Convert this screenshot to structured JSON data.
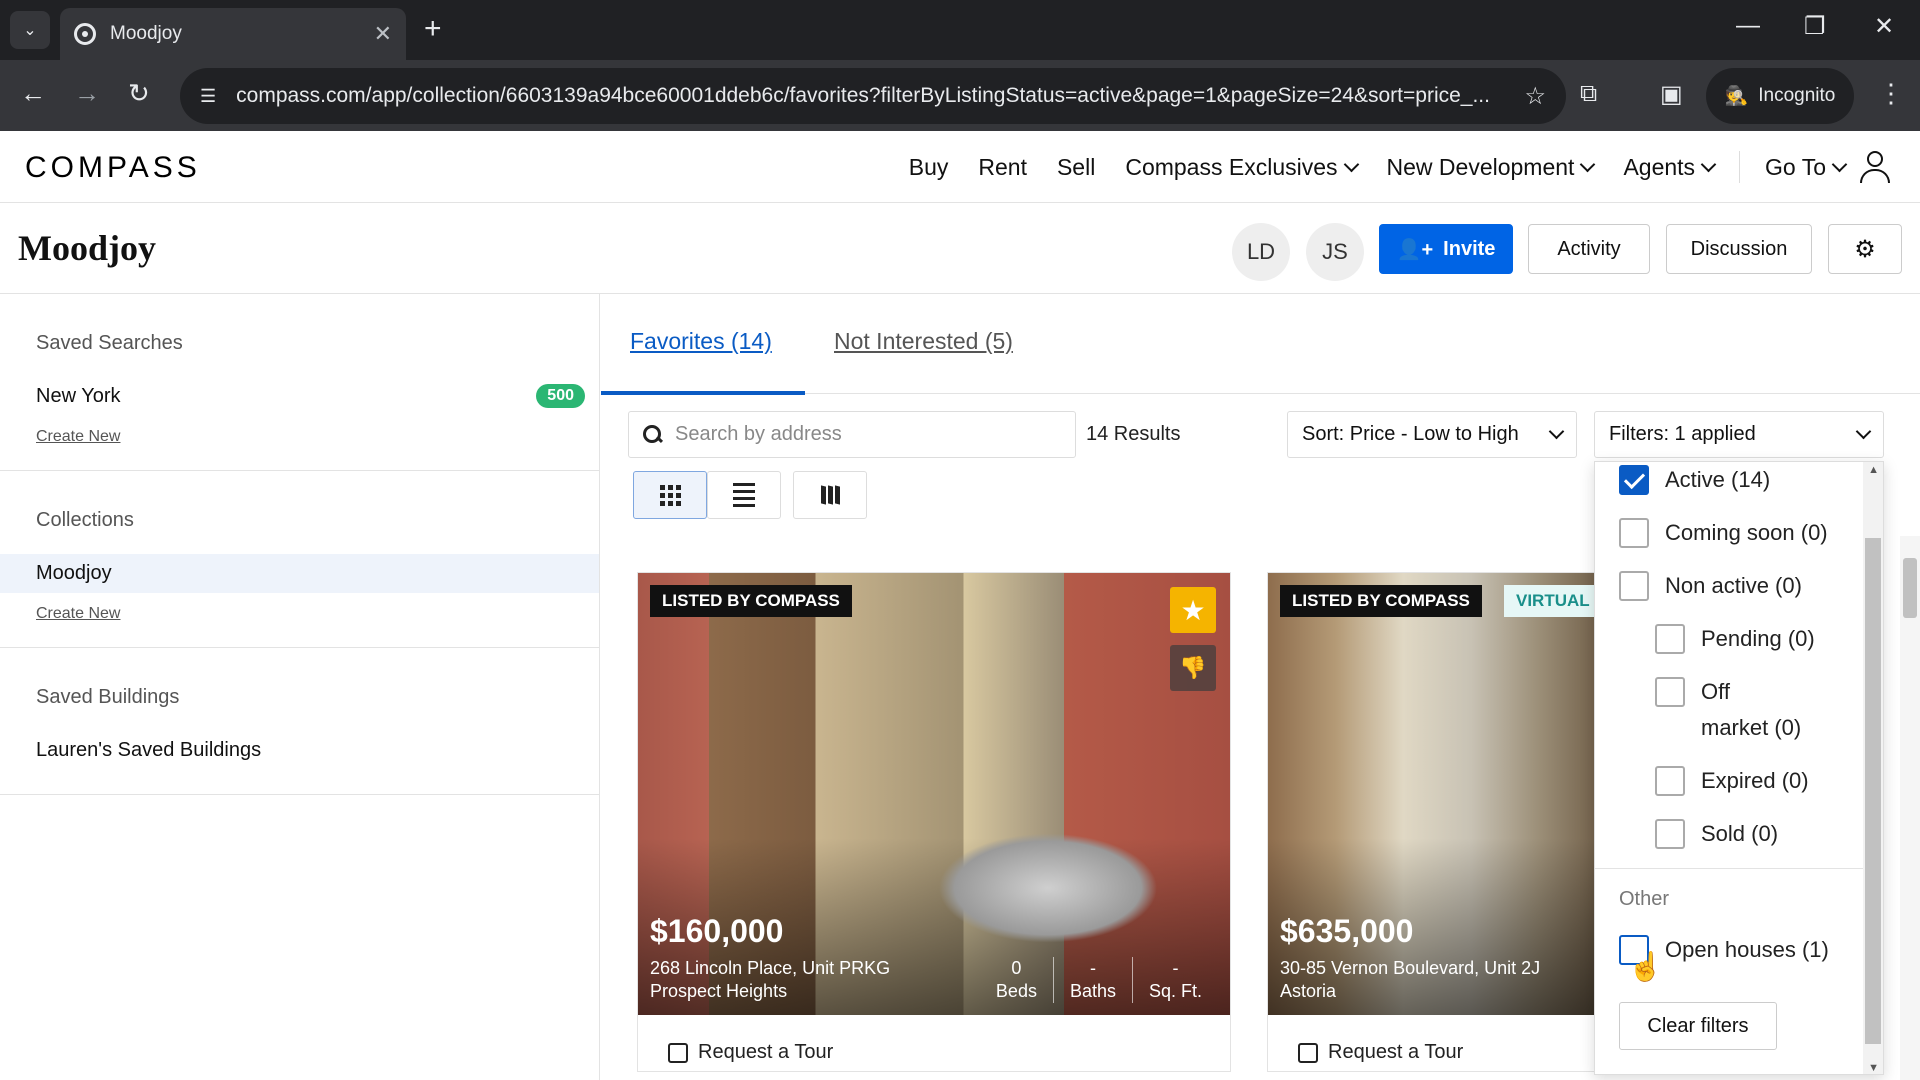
{
  "browser": {
    "tab_title": "Moodjoy",
    "url": "compass.com/app/collection/6603139a94bce60001ddeb6c/favorites?filterByListingStatus=active&page=1&pageSize=24&sort=price_...",
    "incognito_label": "Incognito"
  },
  "site": {
    "logo": "COMPASS",
    "nav": [
      "Buy",
      "Rent",
      "Sell",
      "Compass Exclusives",
      "New Development",
      "Agents",
      "Go To"
    ]
  },
  "collection": {
    "title": "Moodjoy",
    "avatars": [
      "LD",
      "JS"
    ],
    "invite_label": "Invite",
    "activity_label": "Activity",
    "discussion_label": "Discussion"
  },
  "sidebar": {
    "saved_searches_heading": "Saved Searches",
    "saved_search_item": "New York",
    "saved_search_count": "500",
    "create_new_1": "Create New",
    "collections_heading": "Collections",
    "collection_item": "Moodjoy",
    "create_new_2": "Create New",
    "saved_buildings_heading": "Saved Buildings",
    "saved_buildings_item": "Lauren's Saved Buildings"
  },
  "main": {
    "tab_favorites": "Favorites (14)",
    "tab_not_interested": "Not Interested (5)",
    "search_placeholder": "Search by address",
    "results": "14 Results",
    "sort_label": "Sort: Price - Low to High",
    "filters_label": "Filters: 1 applied"
  },
  "listings": [
    {
      "badge": "LISTED BY COMPASS",
      "price": "$160,000",
      "address_line1": "268 Lincoln Place, Unit PRKG",
      "address_line2": "Prospect Heights",
      "beds_value": "0",
      "beds_label": "Beds",
      "baths_value": "-",
      "baths_label": "Baths",
      "sqft_value": "-",
      "sqft_label": "Sq. Ft.",
      "tour_label": "Request a Tour"
    },
    {
      "badge": "LISTED BY COMPASS",
      "badge2": "VIRTUAL",
      "price": "$635,000",
      "address_line1": "30-85 Vernon Boulevard, Unit 2J",
      "address_line2": "Astoria",
      "tour_label": "Request a Tour"
    }
  ],
  "filter_panel": {
    "status_options": [
      {
        "label": "Active (14)",
        "checked": true
      },
      {
        "label": "Coming soon (0)",
        "checked": false
      },
      {
        "label": "Non active (0)",
        "checked": false
      },
      {
        "label": "Pending (0)",
        "checked": false
      },
      {
        "label": "Off",
        "checked": false
      },
      {
        "label": "market (0)",
        "checked": false
      },
      {
        "label": "Expired (0)",
        "checked": false
      },
      {
        "label": "Sold (0)",
        "checked": false
      }
    ],
    "other_heading": "Other",
    "open_houses": "Open houses (1)",
    "clear_label": "Clear filters"
  },
  "colors": {
    "accent": "#0064e5",
    "link_active": "#0a5bc4",
    "badge_green": "#2bb673",
    "favorite_star": "#f5b400"
  }
}
